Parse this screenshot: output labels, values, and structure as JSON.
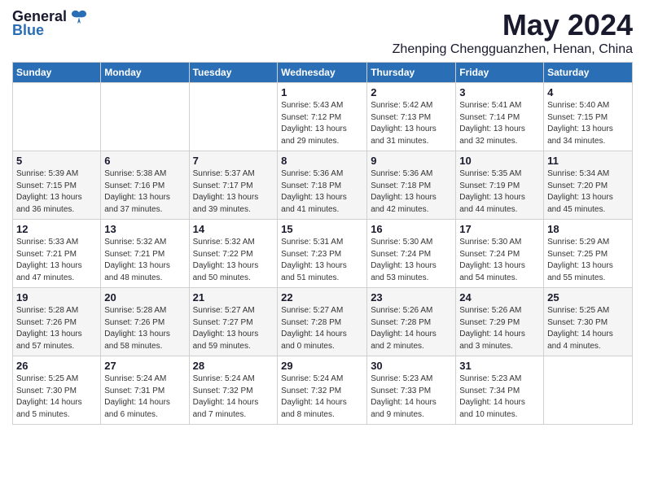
{
  "header": {
    "logo_general": "General",
    "logo_blue": "Blue",
    "month_title": "May 2024",
    "location": "Zhenping Chengguanzhen, Henan, China"
  },
  "weekdays": [
    "Sunday",
    "Monday",
    "Tuesday",
    "Wednesday",
    "Thursday",
    "Friday",
    "Saturday"
  ],
  "weeks": [
    [
      {
        "day": "",
        "info": ""
      },
      {
        "day": "",
        "info": ""
      },
      {
        "day": "",
        "info": ""
      },
      {
        "day": "1",
        "info": "Sunrise: 5:43 AM\nSunset: 7:12 PM\nDaylight: 13 hours\nand 29 minutes."
      },
      {
        "day": "2",
        "info": "Sunrise: 5:42 AM\nSunset: 7:13 PM\nDaylight: 13 hours\nand 31 minutes."
      },
      {
        "day": "3",
        "info": "Sunrise: 5:41 AM\nSunset: 7:14 PM\nDaylight: 13 hours\nand 32 minutes."
      },
      {
        "day": "4",
        "info": "Sunrise: 5:40 AM\nSunset: 7:15 PM\nDaylight: 13 hours\nand 34 minutes."
      }
    ],
    [
      {
        "day": "5",
        "info": "Sunrise: 5:39 AM\nSunset: 7:15 PM\nDaylight: 13 hours\nand 36 minutes."
      },
      {
        "day": "6",
        "info": "Sunrise: 5:38 AM\nSunset: 7:16 PM\nDaylight: 13 hours\nand 37 minutes."
      },
      {
        "day": "7",
        "info": "Sunrise: 5:37 AM\nSunset: 7:17 PM\nDaylight: 13 hours\nand 39 minutes."
      },
      {
        "day": "8",
        "info": "Sunrise: 5:36 AM\nSunset: 7:18 PM\nDaylight: 13 hours\nand 41 minutes."
      },
      {
        "day": "9",
        "info": "Sunrise: 5:36 AM\nSunset: 7:18 PM\nDaylight: 13 hours\nand 42 minutes."
      },
      {
        "day": "10",
        "info": "Sunrise: 5:35 AM\nSunset: 7:19 PM\nDaylight: 13 hours\nand 44 minutes."
      },
      {
        "day": "11",
        "info": "Sunrise: 5:34 AM\nSunset: 7:20 PM\nDaylight: 13 hours\nand 45 minutes."
      }
    ],
    [
      {
        "day": "12",
        "info": "Sunrise: 5:33 AM\nSunset: 7:21 PM\nDaylight: 13 hours\nand 47 minutes."
      },
      {
        "day": "13",
        "info": "Sunrise: 5:32 AM\nSunset: 7:21 PM\nDaylight: 13 hours\nand 48 minutes."
      },
      {
        "day": "14",
        "info": "Sunrise: 5:32 AM\nSunset: 7:22 PM\nDaylight: 13 hours\nand 50 minutes."
      },
      {
        "day": "15",
        "info": "Sunrise: 5:31 AM\nSunset: 7:23 PM\nDaylight: 13 hours\nand 51 minutes."
      },
      {
        "day": "16",
        "info": "Sunrise: 5:30 AM\nSunset: 7:24 PM\nDaylight: 13 hours\nand 53 minutes."
      },
      {
        "day": "17",
        "info": "Sunrise: 5:30 AM\nSunset: 7:24 PM\nDaylight: 13 hours\nand 54 minutes."
      },
      {
        "day": "18",
        "info": "Sunrise: 5:29 AM\nSunset: 7:25 PM\nDaylight: 13 hours\nand 55 minutes."
      }
    ],
    [
      {
        "day": "19",
        "info": "Sunrise: 5:28 AM\nSunset: 7:26 PM\nDaylight: 13 hours\nand 57 minutes."
      },
      {
        "day": "20",
        "info": "Sunrise: 5:28 AM\nSunset: 7:26 PM\nDaylight: 13 hours\nand 58 minutes."
      },
      {
        "day": "21",
        "info": "Sunrise: 5:27 AM\nSunset: 7:27 PM\nDaylight: 13 hours\nand 59 minutes."
      },
      {
        "day": "22",
        "info": "Sunrise: 5:27 AM\nSunset: 7:28 PM\nDaylight: 14 hours\nand 0 minutes."
      },
      {
        "day": "23",
        "info": "Sunrise: 5:26 AM\nSunset: 7:28 PM\nDaylight: 14 hours\nand 2 minutes."
      },
      {
        "day": "24",
        "info": "Sunrise: 5:26 AM\nSunset: 7:29 PM\nDaylight: 14 hours\nand 3 minutes."
      },
      {
        "day": "25",
        "info": "Sunrise: 5:25 AM\nSunset: 7:30 PM\nDaylight: 14 hours\nand 4 minutes."
      }
    ],
    [
      {
        "day": "26",
        "info": "Sunrise: 5:25 AM\nSunset: 7:30 PM\nDaylight: 14 hours\nand 5 minutes."
      },
      {
        "day": "27",
        "info": "Sunrise: 5:24 AM\nSunset: 7:31 PM\nDaylight: 14 hours\nand 6 minutes."
      },
      {
        "day": "28",
        "info": "Sunrise: 5:24 AM\nSunset: 7:32 PM\nDaylight: 14 hours\nand 7 minutes."
      },
      {
        "day": "29",
        "info": "Sunrise: 5:24 AM\nSunset: 7:32 PM\nDaylight: 14 hours\nand 8 minutes."
      },
      {
        "day": "30",
        "info": "Sunrise: 5:23 AM\nSunset: 7:33 PM\nDaylight: 14 hours\nand 9 minutes."
      },
      {
        "day": "31",
        "info": "Sunrise: 5:23 AM\nSunset: 7:34 PM\nDaylight: 14 hours\nand 10 minutes."
      },
      {
        "day": "",
        "info": ""
      }
    ]
  ]
}
